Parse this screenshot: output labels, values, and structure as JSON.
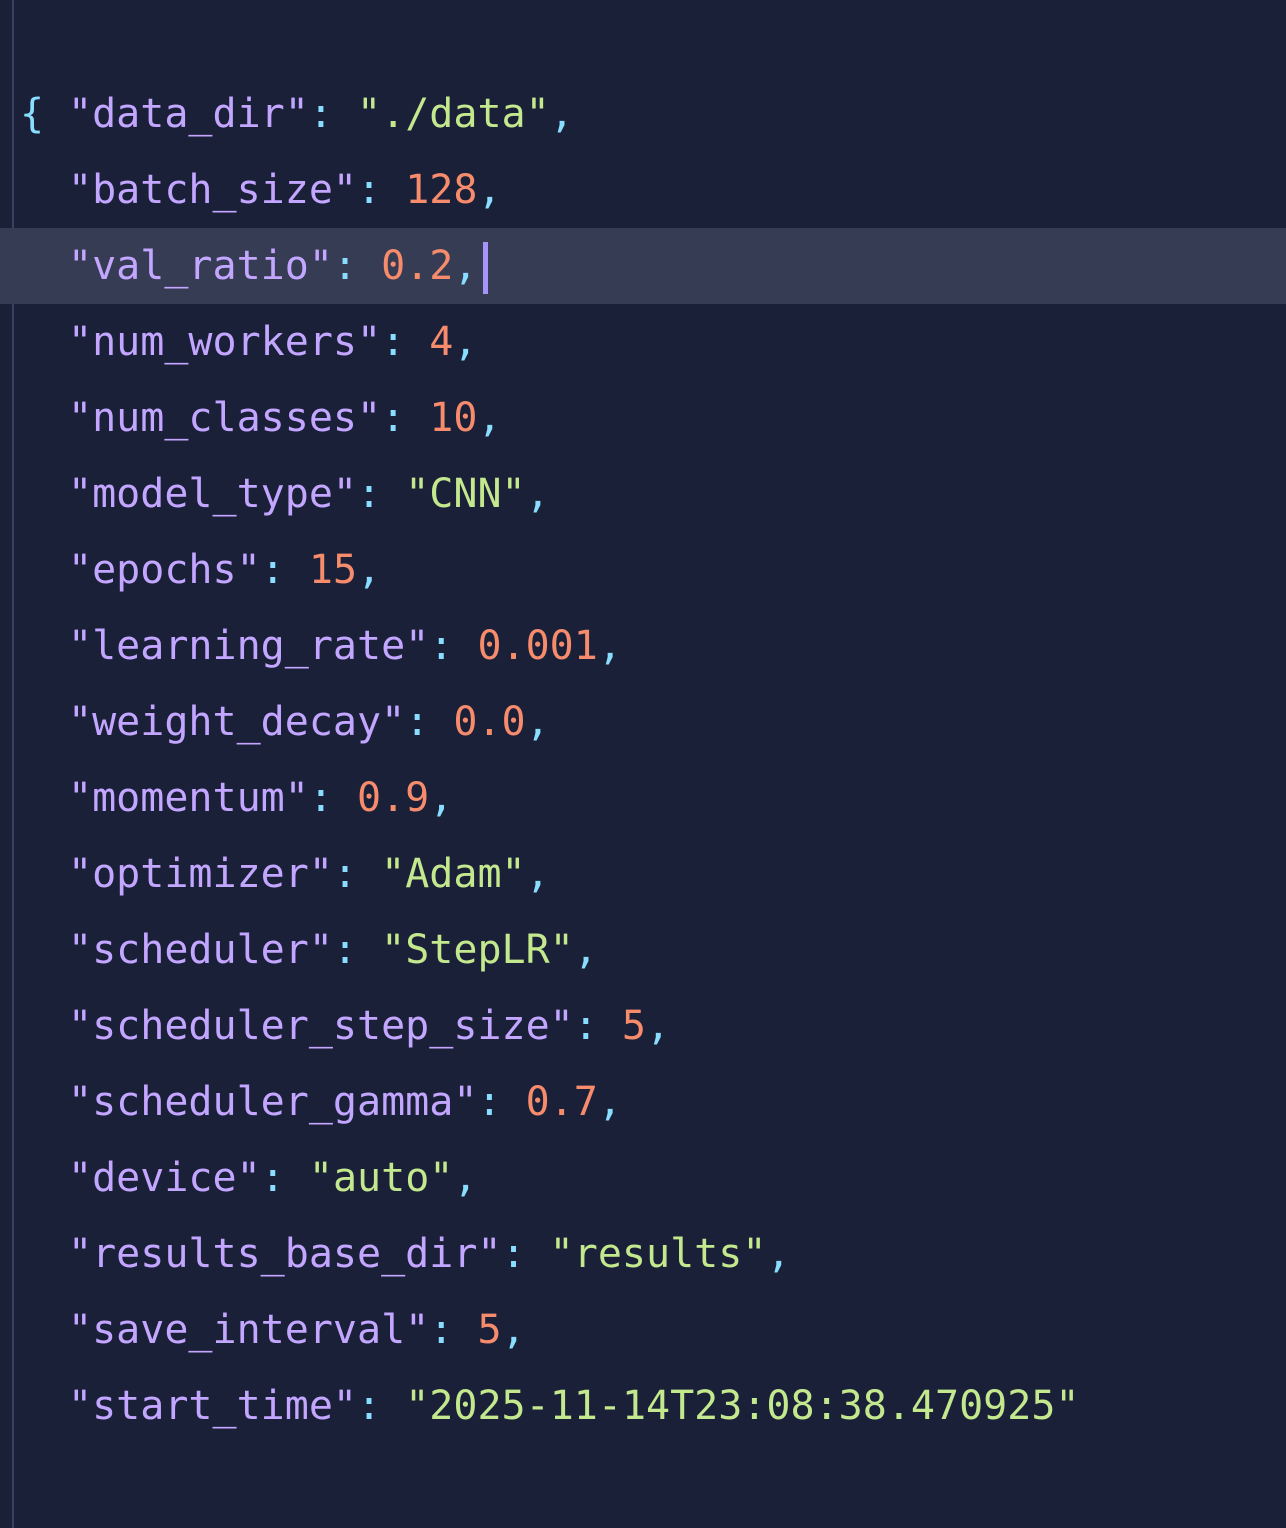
{
  "editor": {
    "open_brace": "{",
    "close_brace": "}",
    "current_line_index": 2,
    "lines": [
      {
        "key": "data_dir",
        "value": "./data",
        "type": "string",
        "comma": ","
      },
      {
        "key": "batch_size",
        "value": "128",
        "type": "number",
        "comma": ","
      },
      {
        "key": "val_ratio",
        "value": "0.2",
        "type": "number",
        "comma": ","
      },
      {
        "key": "num_workers",
        "value": "4",
        "type": "number",
        "comma": ","
      },
      {
        "key": "num_classes",
        "value": "10",
        "type": "number",
        "comma": ","
      },
      {
        "key": "model_type",
        "value": "CNN",
        "type": "string",
        "comma": ","
      },
      {
        "key": "epochs",
        "value": "15",
        "type": "number",
        "comma": ","
      },
      {
        "key": "learning_rate",
        "value": "0.001",
        "type": "number",
        "comma": ","
      },
      {
        "key": "weight_decay",
        "value": "0.0",
        "type": "number",
        "comma": ","
      },
      {
        "key": "momentum",
        "value": "0.9",
        "type": "number",
        "comma": ","
      },
      {
        "key": "optimizer",
        "value": "Adam",
        "type": "string",
        "comma": ","
      },
      {
        "key": "scheduler",
        "value": "StepLR",
        "type": "string",
        "comma": ","
      },
      {
        "key": "scheduler_step_size",
        "value": "5",
        "type": "number",
        "comma": ","
      },
      {
        "key": "scheduler_gamma",
        "value": "0.7",
        "type": "number",
        "comma": ","
      },
      {
        "key": "device",
        "value": "auto",
        "type": "string",
        "comma": ","
      },
      {
        "key": "results_base_dir",
        "value": "results",
        "type": "string",
        "comma": ","
      },
      {
        "key": "save_interval",
        "value": "5",
        "type": "number",
        "comma": ","
      },
      {
        "key": "start_time",
        "value": "2025-11-14T23:08:38.470925",
        "type": "string",
        "comma": ""
      }
    ]
  },
  "colors": {
    "background": "#1b2039",
    "current_line": "#373c55",
    "key": "#c3a6ff",
    "punctuation": "#89ddff",
    "number": "#f78c6c",
    "string": "#c3e88d",
    "caret": "#a594f9"
  }
}
